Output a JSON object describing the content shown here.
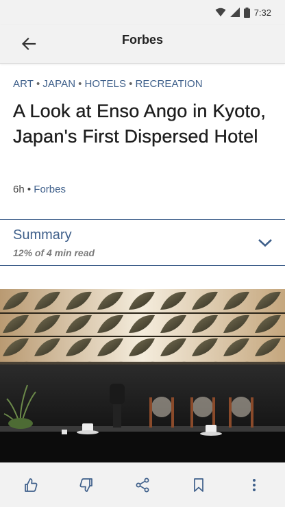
{
  "status_bar": {
    "time": "7:32"
  },
  "app_bar": {
    "title": "Forbes",
    "back_icon": "arrow-left-icon"
  },
  "article": {
    "categories": [
      "ART",
      "JAPAN",
      "HOTELS",
      "RECREATION"
    ],
    "headline": "A Look at Enso Ango in Kyoto, Japan's First Dispersed Hotel",
    "age": "6h",
    "source": "Forbes"
  },
  "summary": {
    "title": "Summary",
    "progress": "12% of 4 min read",
    "expand_icon": "chevron-down-icon"
  },
  "actions": [
    {
      "name": "like",
      "icon": "thumbs-up-icon"
    },
    {
      "name": "dislike",
      "icon": "thumbs-down-icon"
    },
    {
      "name": "share",
      "icon": "share-icon"
    },
    {
      "name": "bookmark",
      "icon": "bookmark-icon"
    },
    {
      "name": "more",
      "icon": "more-vert-icon"
    }
  ],
  "colors": {
    "accent": "#3e5f8a",
    "bar_bg": "#f2f2f2"
  }
}
